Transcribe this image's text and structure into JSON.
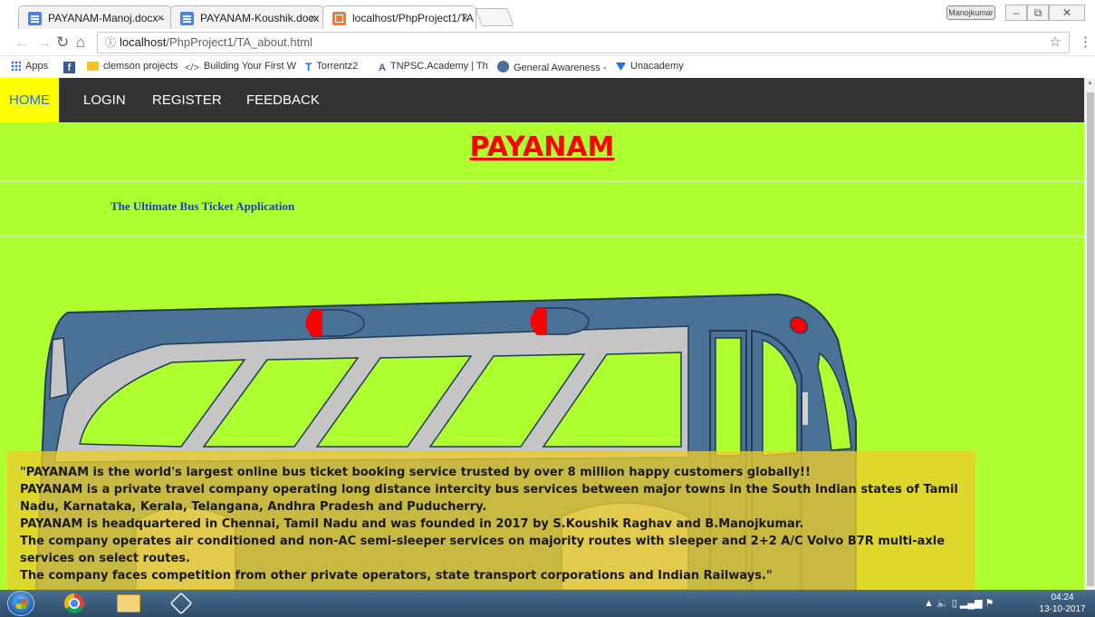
{
  "browser": {
    "tabs": [
      {
        "title": "PAYANAM-Manoj.docx -",
        "icon": "google-docs-icon",
        "active": false
      },
      {
        "title": "PAYANAM-Koushik.docx",
        "icon": "google-docs-icon",
        "active": false
      },
      {
        "title": "localhost/PhpProject1/TA",
        "icon": "xampp-icon",
        "active": true
      }
    ],
    "close_glyph": "×",
    "window_user": "Manojkumar",
    "url_host": "localhost",
    "url_path": "/PhpProject1/TA_about.html",
    "bookmarks": [
      {
        "label": "Apps",
        "icon": "apps-grid-icon"
      },
      {
        "label": "",
        "icon": "facebook-icon"
      },
      {
        "label": "clemson projects",
        "icon": "folder-icon"
      },
      {
        "label": "Building Your First W",
        "icon": "code-icon"
      },
      {
        "label": "Torrentz2",
        "icon": "torrentz-icon"
      },
      {
        "label": "TNPSC.Academy | Th",
        "icon": "tnpsc-icon"
      },
      {
        "label": "General Awareness -",
        "icon": "globe-icon"
      },
      {
        "label": "Unacademy",
        "icon": "unacademy-icon"
      }
    ]
  },
  "nav": {
    "items": [
      {
        "label": "HOME",
        "active": true
      },
      {
        "label": "LOGIN",
        "active": false
      },
      {
        "label": "REGISTER",
        "active": false
      },
      {
        "label": "FEEDBACK",
        "active": false
      }
    ]
  },
  "page": {
    "title": "PAYANAM",
    "tagline": "The Ultimate Bus Ticket Application",
    "about_lines": [
      "\"PAYANAM is the world's largest online bus ticket booking service trusted by over 8 million happy customers globally!!",
      "PAYANAM is a private travel company operating long distance intercity bus services between major towns in the South Indian states of Tamil Nadu, Karnataka, Kerala, Telangana, Andhra Pradesh and Puducherry.",
      "PAYANAM is headquartered in Chennai, Tamil Nadu and was founded in 2017 by S.Koushik Raghav and B.Manojkumar.",
      "The company operates air conditioned and non-AC semi-sleeper services on majority routes with sleeper and 2+2 A/C Volvo B7R multi-axle services on select routes.",
      "The company faces competition from other private operators, state transport corporations and Indian Railways.\""
    ],
    "colors": {
      "background": "#adff2f",
      "navbar": "#333333",
      "nav_active": "#ffff00",
      "title": "#ff0000",
      "tagline": "#1f3ebf",
      "about_overlay": "#eacd2a",
      "bus_body": "#4a7296"
    }
  },
  "taskbar": {
    "time": "04:24",
    "date": "13-10-2017"
  }
}
